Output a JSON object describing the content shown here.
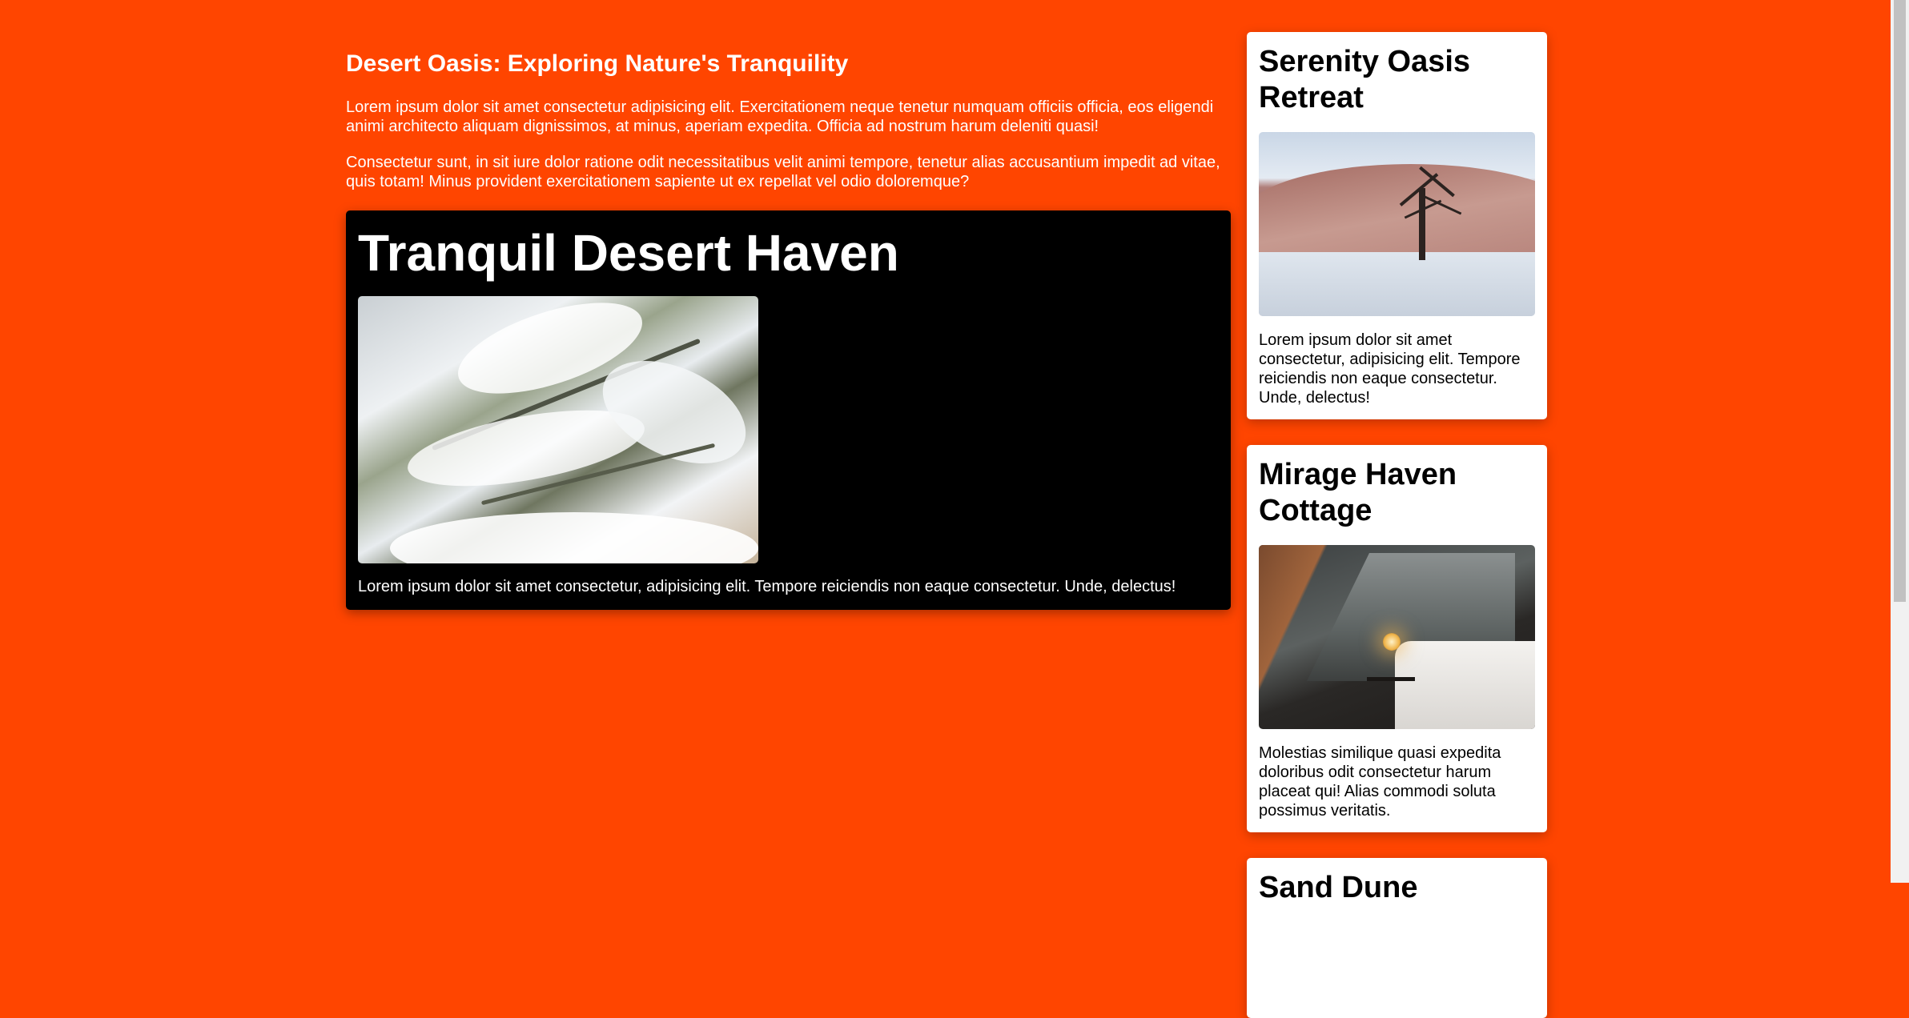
{
  "main": {
    "title": "Desert Oasis: Exploring Nature's Tranquility",
    "paragraphs": [
      "Lorem ipsum dolor sit amet consectetur adipisicing elit. Exercitationem neque tenetur numquam officiis officia, eos eligendi animi architecto aliquam dignissimos, at minus, aperiam expedita. Officia ad nostrum harum deleniti quasi!",
      "Consectetur sunt, in sit iure dolor ratione odit necessitatibus velit animi tempore, tenetur alias accusantium impedit ad vitae, quis totam! Minus provident exercitationem sapiente ut ex repellat vel odio doloremque?"
    ],
    "featured": {
      "title": "Tranquil Desert Haven",
      "image_alt": "snow-covered-pine-branches",
      "text": "Lorem ipsum dolor sit amet consectetur, adipisicing elit. Tempore reiciendis non eaque consectetur. Unde, delectus!"
    }
  },
  "sidebar": {
    "cards": [
      {
        "title": "Serenity Oasis Retreat",
        "image_alt": "desert-dead-tree",
        "text": "Lorem ipsum dolor sit amet consectetur, adipisicing elit. Tempore reiciendis non eaque consectetur. Unde, delectus!"
      },
      {
        "title": "Mirage Haven Cottage",
        "image_alt": "cozy-cabin-bedroom",
        "text": "Molestias similique quasi expedita doloribus odit consectetur harum placeat qui! Alias commodi soluta possimus veritatis."
      },
      {
        "title": "Sand Dune"
      }
    ]
  },
  "colors": {
    "background": "#ff4500",
    "featured_bg": "#000000",
    "card_bg": "#ffffff",
    "text_light": "#ffffff",
    "text_dark": "#000000"
  }
}
